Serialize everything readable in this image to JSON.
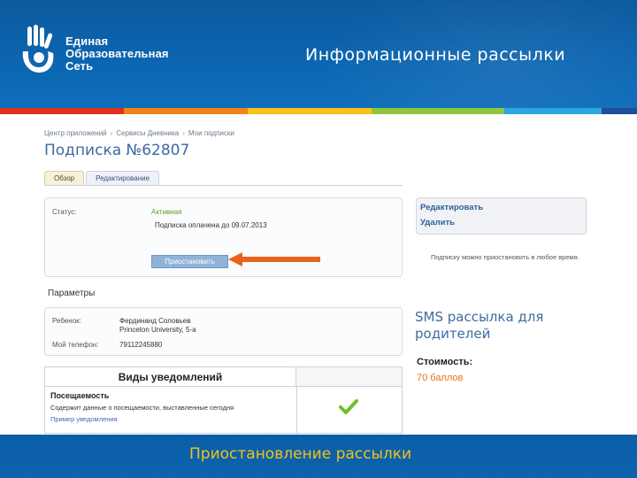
{
  "header": {
    "logo_lines": [
      "Единая",
      "Образовательная",
      "Сеть"
    ],
    "slide_title": "Информационные рассылки"
  },
  "stripe_colors": [
    "#e2301e",
    "#f0821c",
    "#f9c219",
    "#8cc63f",
    "#2aa7df",
    "#1f4e9c"
  ],
  "breadcrumb": [
    "Центр приложений",
    "Сервисы Дневника",
    "Мои подписки"
  ],
  "page_title": "Подписка №62807",
  "tabs": [
    {
      "label": "Обзор",
      "active": true
    },
    {
      "label": "Редактирование",
      "active": false
    }
  ],
  "status": {
    "label": "Статус:",
    "value": "Активная",
    "paid_until": "Подписка оплачена до 09.07.2013",
    "pause_button": "Приостановить"
  },
  "params": {
    "title": "Параметры",
    "child_label": "Ребенок:",
    "child_name": "Фердинанд Соловьев",
    "child_school": "Princeton University, 5-а",
    "phone_label": "Мой телефон:",
    "phone_value": "79112245880"
  },
  "notifications": {
    "header": "Виды уведомлений",
    "row_title": "Посещаемость",
    "row_desc": "Содержит данные о посещаемости, выставленные сегодня",
    "row_link": "Пример уведомления",
    "checked": true
  },
  "actions": {
    "edit": "Редактировать",
    "delete": "Удалить"
  },
  "pause_note": "Подписку можно приостановить в любое время.",
  "sms": {
    "title": "SMS рассылка для родителей",
    "cost_label": "Стоимость:",
    "cost_value": "70 баллов"
  },
  "footer": {
    "title": "Приостановление рассылки"
  },
  "colors": {
    "header_blue": "#0c65b0",
    "footer_title": "#f2c21a",
    "arrow": "#e8631c",
    "status_active": "#5aa02c",
    "cost": "#e2741c"
  },
  "icons": [
    "logo-hand-icon",
    "arrow-pointer-icon",
    "checkmark-icon"
  ]
}
